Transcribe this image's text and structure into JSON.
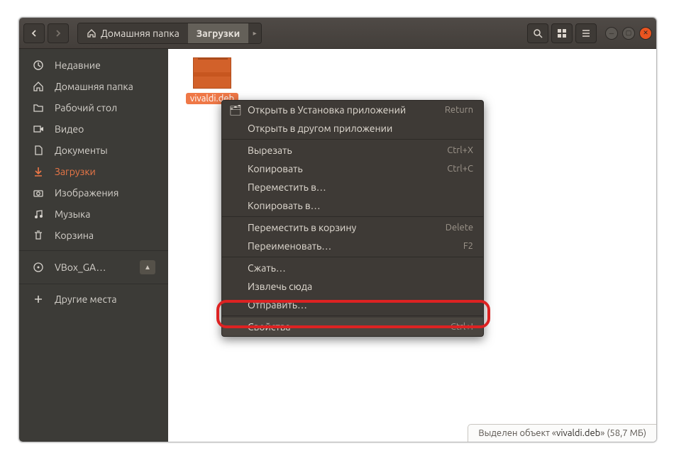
{
  "titlebar": {
    "home_crumb": "Домашняя папка",
    "active_crumb": "Загрузки"
  },
  "sidebar": {
    "items": [
      {
        "icon": "clock",
        "label": "Недавние"
      },
      {
        "icon": "home",
        "label": "Домашняя папка"
      },
      {
        "icon": "folder",
        "label": "Рабочий стол"
      },
      {
        "icon": "video",
        "label": "Видео"
      },
      {
        "icon": "doc",
        "label": "Документы"
      },
      {
        "icon": "download",
        "label": "Загрузки",
        "active": true
      },
      {
        "icon": "camera",
        "label": "Изображения"
      },
      {
        "icon": "music",
        "label": "Музыка"
      },
      {
        "icon": "trash",
        "label": "Корзина"
      }
    ],
    "disk": {
      "icon": "disc",
      "label": "VBox_GA…"
    },
    "other": {
      "icon": "plus",
      "label": "Другие места"
    }
  },
  "file": {
    "name": "vivaldi.deb"
  },
  "context_menu": {
    "open_default": "Открыть в Установка приложений",
    "open_default_accel": "Return",
    "open_with": "Открыть в другом приложении",
    "cut": "Вырезать",
    "cut_accel": "Ctrl+X",
    "copy": "Копировать",
    "copy_accel": "Ctrl+C",
    "move_to": "Переместить в…",
    "copy_to": "Копировать в…",
    "trash": "Переместить в корзину",
    "trash_accel": "Delete",
    "rename": "Переименовать…",
    "rename_accel": "F2",
    "compress": "Сжать…",
    "extract": "Извлечь сюда",
    "send": "Отправить…",
    "properties": "Свойства",
    "properties_accel": "Ctrl+I"
  },
  "status": {
    "prefix": "Выделен объект «",
    "object": "vivaldi.deb",
    "suffix": "»  (58,7 МБ)"
  }
}
